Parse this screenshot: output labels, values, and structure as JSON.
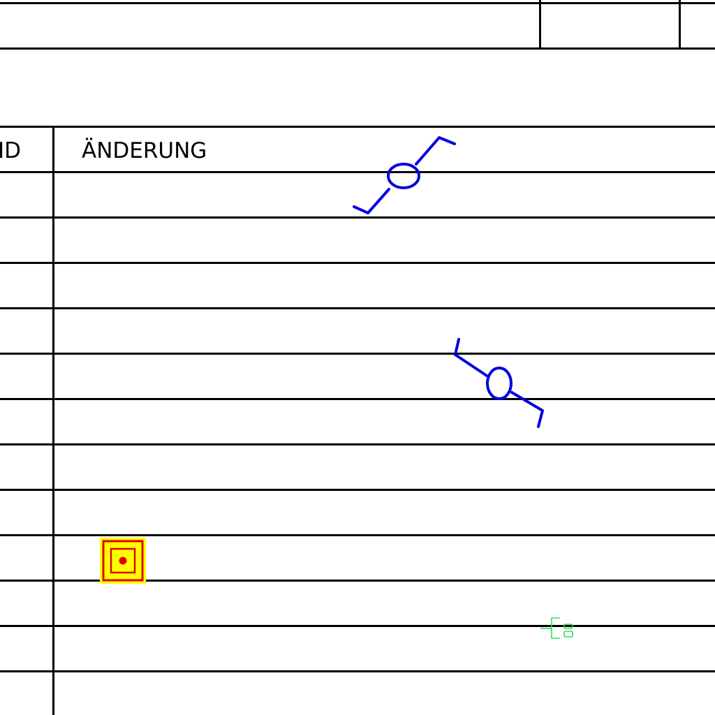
{
  "title_block": {
    "cells": [
      "",
      "",
      ""
    ]
  },
  "revision_table": {
    "columns": [
      {
        "key": "id",
        "label": "ID"
      },
      {
        "key": "change",
        "label": "ÄNDERUNG"
      }
    ],
    "rows": [
      {
        "id": "",
        "change": ""
      },
      {
        "id": "",
        "change": ""
      },
      {
        "id": "",
        "change": ""
      },
      {
        "id": "",
        "change": ""
      },
      {
        "id": "",
        "change": ""
      },
      {
        "id": "",
        "change": ""
      },
      {
        "id": "",
        "change": ""
      },
      {
        "id": "",
        "change": ""
      },
      {
        "id": "",
        "change": ""
      },
      {
        "id": "",
        "change": ""
      },
      {
        "id": "",
        "change": ""
      }
    ]
  },
  "markers": {
    "section_cut_1": {
      "icon": "section-cut-icon",
      "color": "#0000e0"
    },
    "section_cut_2": {
      "icon": "section-cut-icon",
      "color": "#0000e0"
    },
    "snap_point": {
      "icon": "snap-point-icon",
      "fill": "#ffff00",
      "stroke": "#e00000"
    },
    "cursor": {
      "icon": "selection-cursor-icon",
      "color": "#33dd55"
    }
  }
}
